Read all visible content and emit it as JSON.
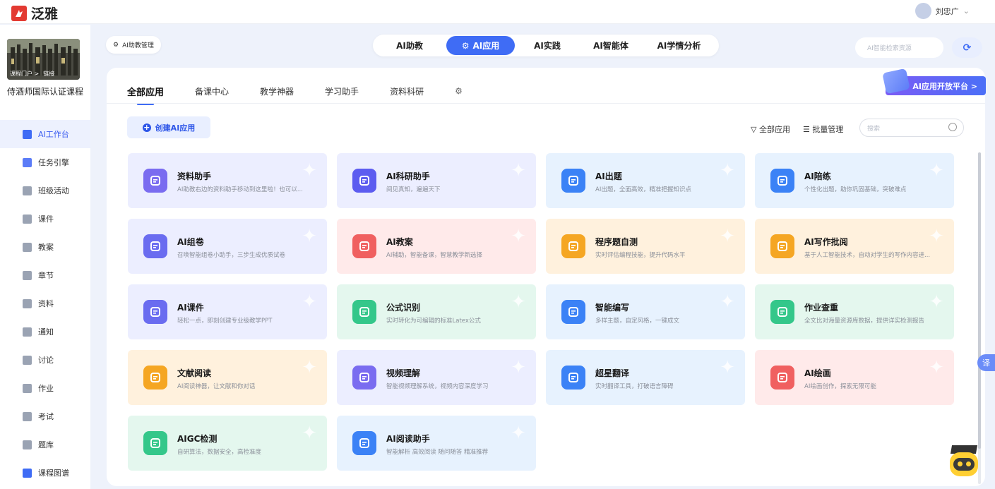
{
  "app": {
    "name": "泛雅",
    "brand_color": "#e33a32"
  },
  "user": {
    "name": "刘忠广"
  },
  "sidebar": {
    "course_tags": [
      "课程门户 >",
      "链接"
    ],
    "course_title": "侍酒师国际认证课程",
    "items": [
      {
        "label": "AI工作台",
        "icon": "ai-workbench-icon",
        "active": true,
        "color": "#3f6cf5"
      },
      {
        "label": "任务引擎",
        "icon": "task-engine-icon",
        "color": "#5b7cf7"
      },
      {
        "label": "班级活动",
        "icon": "class-activity-icon",
        "color": "#9aa3b3"
      },
      {
        "label": "课件",
        "icon": "courseware-icon",
        "color": "#9aa3b3"
      },
      {
        "label": "教案",
        "icon": "lesson-plan-icon",
        "color": "#9aa3b3"
      },
      {
        "label": "章节",
        "icon": "chapter-icon",
        "color": "#9aa3b3"
      },
      {
        "label": "资料",
        "icon": "folder-icon",
        "color": "#9aa3b3"
      },
      {
        "label": "通知",
        "icon": "speaker-icon",
        "color": "#9aa3b3"
      },
      {
        "label": "讨论",
        "icon": "chat-icon",
        "color": "#9aa3b3"
      },
      {
        "label": "作业",
        "icon": "homework-icon",
        "color": "#9aa3b3"
      },
      {
        "label": "考试",
        "icon": "exam-icon",
        "color": "#9aa3b3"
      },
      {
        "label": "题库",
        "icon": "question-bank-icon",
        "color": "#9aa3b3"
      },
      {
        "label": "课程图谱",
        "icon": "course-graph-icon",
        "color": "#3f6cf5"
      }
    ]
  },
  "header": {
    "ai_manager": "AI助教管理",
    "tabs": [
      "AI助教",
      "AI应用",
      "AI实践",
      "AI智能体",
      "AI学情分析"
    ],
    "active_tab": "AI应用",
    "search_placeholder": "AI智能检索资源"
  },
  "panel": {
    "sub_tabs": [
      "全部应用",
      "备课中心",
      "教学神器",
      "学习助手",
      "资料科研"
    ],
    "open_platform": "AI应用开放平台 >",
    "create_button": "创建AI应用",
    "filter_all": "全部应用",
    "batch_manage": "批量管理",
    "search_placeholder": "搜索"
  },
  "apps": [
    {
      "title": "资料助手",
      "desc": "AI助教右边的资料助手移动到这里啦！也可以...",
      "icon": "chart-bubble-icon",
      "icon_color": "#7a6cf0",
      "bg": "#eceeff"
    },
    {
      "title": "AI科研助手",
      "desc": "阅见真知，遍遍天下",
      "icon": "wave-icon",
      "icon_color": "#5c5cf0",
      "bg": "#eceeff"
    },
    {
      "title": "AI出题",
      "desc": "AI出题，全面高效，精准把握知识点",
      "icon": "question-doc-icon",
      "icon_color": "#3b82f6",
      "bg": "#e7f2fe"
    },
    {
      "title": "AI陪练",
      "desc": "个性化出题，助你巩固基础，突破难点",
      "icon": "tutor-icon",
      "icon_color": "#3b82f6",
      "bg": "#e7f2fe"
    },
    {
      "title": "AI组卷",
      "desc": "召唤智能组卷小助手，三步生成优质试卷",
      "icon": "stack-icon",
      "icon_color": "#6a6cf0",
      "bg": "#eceeff"
    },
    {
      "title": "AI教案",
      "desc": "AI辅助，智能备课，智慧教学新选择",
      "icon": "lesson-doc-icon",
      "icon_color": "#f06060",
      "bg": "#ffeaea"
    },
    {
      "title": "程序题自测",
      "desc": "实时评估编程技能，提升代码水平",
      "icon": "code-icon",
      "icon_color": "#f5a623",
      "bg": "#fff1dd"
    },
    {
      "title": "AI写作批阅",
      "desc": "基于人工智能技术，自动对学生的写作内容进...",
      "icon": "writing-check-icon",
      "icon_color": "#f5a623",
      "bg": "#fff1dd"
    },
    {
      "title": "AI课件",
      "desc": "轻松一点，即刻创建专业级教学PPT",
      "icon": "ppt-icon",
      "icon_color": "#6a6cf0",
      "bg": "#eceeff"
    },
    {
      "title": "公式识别",
      "desc": "实时转化为可编辑的标准Latex公式",
      "icon": "formula-icon",
      "icon_color": "#34c78a",
      "bg": "#e4f7ee"
    },
    {
      "title": "智能编写",
      "desc": "多样主题，自定风格，一键成文",
      "icon": "edit-icon",
      "icon_color": "#3b82f6",
      "bg": "#e7f2fe"
    },
    {
      "title": "作业查重",
      "desc": "全文比对海量资源库数据，提供详实检测报告",
      "icon": "duplicate-check-icon",
      "icon_color": "#34c78a",
      "bg": "#e4f7ee"
    },
    {
      "title": "文献阅读",
      "desc": "AI阅读神器，让文献和你对话",
      "icon": "book-icon",
      "icon_color": "#f5a623",
      "bg": "#fff1dd"
    },
    {
      "title": "视频理解",
      "desc": "智能视频理解系统，视频内容深度学习",
      "icon": "video-icon",
      "icon_color": "#7a6cf0",
      "bg": "#eceeff"
    },
    {
      "title": "超星翻译",
      "desc": "实时翻译工具，打破语言障碍",
      "icon": "translate-icon",
      "icon_color": "#3b82f6",
      "bg": "#e7f2fe"
    },
    {
      "title": "AI绘画",
      "desc": "AI绘画创作，探索无限可能",
      "icon": "palette-icon",
      "icon_color": "#f06060",
      "bg": "#ffeaea"
    },
    {
      "title": "AIGC检测",
      "desc": "自研算法，数据安全，高检准度",
      "icon": "aigc-shield-icon",
      "icon_color": "#34c78a",
      "bg": "#e4f7ee"
    },
    {
      "title": "AI阅读助手",
      "desc": "智能解析 高效阅读 随问随答 精准推荐",
      "icon": "reading-icon",
      "icon_color": "#3b82f6",
      "bg": "#e7f2fe"
    }
  ],
  "floating": {
    "translate": "译"
  }
}
